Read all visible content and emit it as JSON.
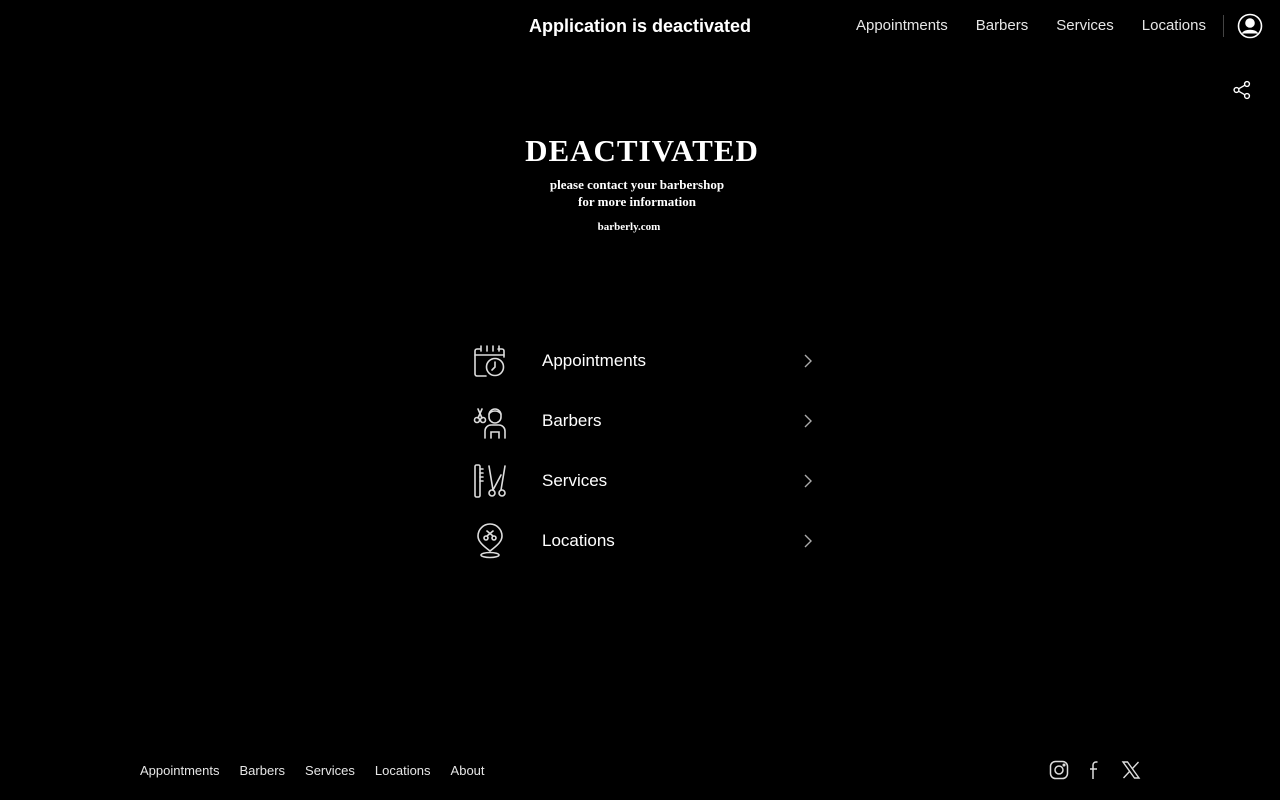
{
  "header": {
    "title": "Application is deactivated",
    "nav": [
      "Appointments",
      "Barbers",
      "Services",
      "Locations"
    ],
    "profile_icon": "user-circle-icon",
    "share_icon": "share-icon"
  },
  "logo": {
    "heading": "DEACTIVATED",
    "line1": "please contact your barbershop",
    "line2": "for more information",
    "url": "barberly.com"
  },
  "menu": {
    "items": [
      {
        "label": "Appointments",
        "icon": "calendar-clock-icon"
      },
      {
        "label": "Barbers",
        "icon": "barber-icon"
      },
      {
        "label": "Services",
        "icon": "comb-scissors-icon"
      },
      {
        "label": "Locations",
        "icon": "location-pin-icon"
      }
    ]
  },
  "footer": {
    "links": [
      "Appointments",
      "Barbers",
      "Services",
      "Locations",
      "About"
    ],
    "social": [
      "instagram-icon",
      "facebook-icon",
      "x-icon"
    ]
  },
  "colors": {
    "background": "#000000",
    "text": "#ffffff",
    "muted": "#e6e6e6"
  }
}
